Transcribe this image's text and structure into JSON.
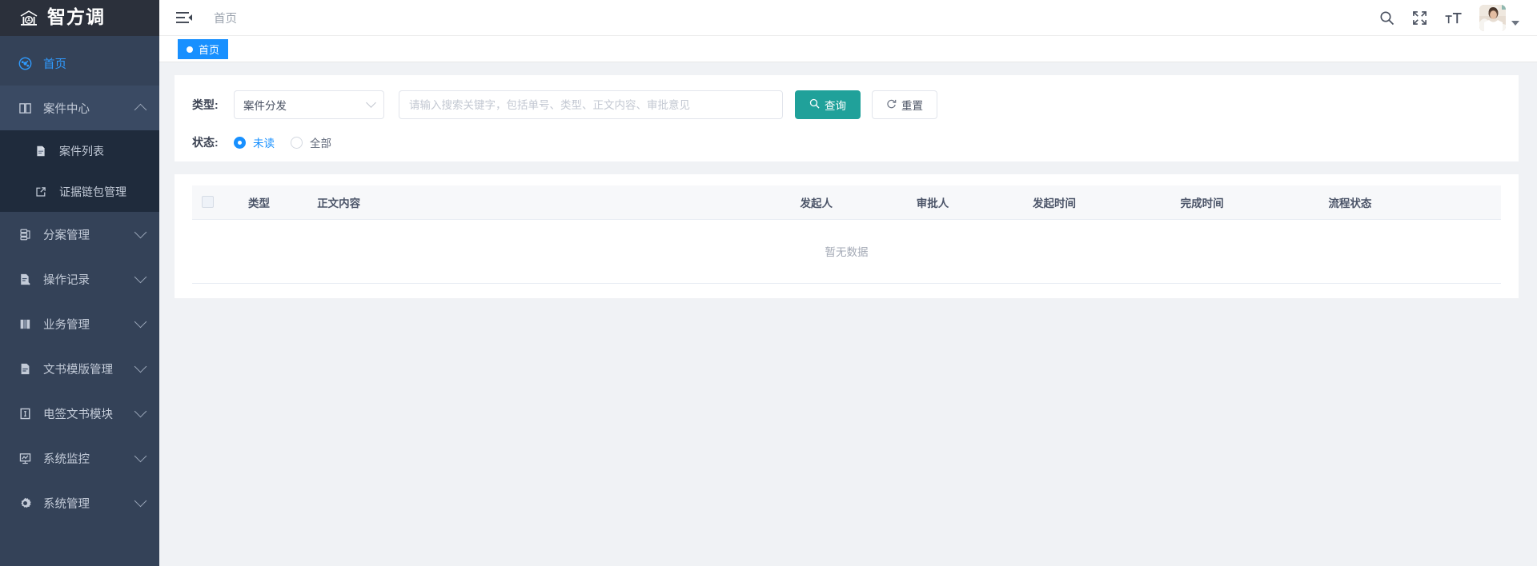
{
  "brand": {
    "name": "智方调",
    "logo_icon": "courthouse-icon"
  },
  "sidebar": {
    "items": [
      {
        "label": "首页",
        "icon": "dashboard-icon",
        "active": true,
        "expandable": false
      },
      {
        "label": "案件中心",
        "icon": "book-open-icon",
        "active": false,
        "expandable": true,
        "expanded": true
      },
      {
        "label": "分案管理",
        "icon": "case-assign-icon",
        "active": false,
        "expandable": true,
        "expanded": false
      },
      {
        "label": "操作记录",
        "icon": "edit-document-icon",
        "active": false,
        "expandable": true,
        "expanded": false
      },
      {
        "label": "业务管理",
        "icon": "books-icon",
        "active": false,
        "expandable": true,
        "expanded": false
      },
      {
        "label": "文书模版管理",
        "icon": "document-icon",
        "active": false,
        "expandable": true,
        "expanded": false
      },
      {
        "label": "电签文书模块",
        "icon": "signature-icon",
        "active": false,
        "expandable": true,
        "expanded": false
      },
      {
        "label": "系统监控",
        "icon": "monitor-chart-icon",
        "active": false,
        "expandable": true,
        "expanded": false
      },
      {
        "label": "系统管理",
        "icon": "gear-icon",
        "active": false,
        "expandable": true,
        "expanded": false
      }
    ],
    "submenu": [
      {
        "label": "案件列表",
        "icon": "file-list-icon"
      },
      {
        "label": "证据链包管理",
        "icon": "external-link-icon"
      }
    ]
  },
  "topbar": {
    "collapse_icon": "menu-fold-icon",
    "breadcrumb": "首页",
    "icons": [
      {
        "name": "search-icon"
      },
      {
        "name": "fullscreen-icon"
      },
      {
        "name": "font-size-icon"
      }
    ],
    "avatar_alt": "user-avatar"
  },
  "tagbar": {
    "tags": [
      {
        "label": "首页",
        "active": true
      }
    ]
  },
  "filter": {
    "type_label": "类型:",
    "type_value": "案件分发",
    "type_options": [
      "案件分发"
    ],
    "search_placeholder": "请输入搜索关键字，包括单号、类型、正文内容、审批意见",
    "search_value": "",
    "query_button": "查询",
    "query_icon": "search-icon",
    "reset_button": "重置",
    "reset_icon": "refresh-icon",
    "status_label": "状态:",
    "status_options": [
      {
        "label": "未读",
        "checked": true
      },
      {
        "label": "全部",
        "checked": false
      }
    ]
  },
  "table": {
    "columns": [
      {
        "key": "check",
        "label": ""
      },
      {
        "key": "type",
        "label": "类型"
      },
      {
        "key": "content",
        "label": "正文内容"
      },
      {
        "key": "initiator",
        "label": "发起人"
      },
      {
        "key": "approver",
        "label": "审批人"
      },
      {
        "key": "start_time",
        "label": "发起时间"
      },
      {
        "key": "finish_time",
        "label": "完成时间"
      },
      {
        "key": "status",
        "label": "流程状态"
      }
    ],
    "rows": [],
    "empty_text": "暂无数据"
  },
  "colors": {
    "sidebar_bg": "#344258",
    "sidebar_header_bg": "#2b303b",
    "submenu_bg": "#1f2b3c",
    "accent_blue": "#1890ff",
    "primary_teal": "#20a19a",
    "page_bg": "#f0f2f5"
  }
}
